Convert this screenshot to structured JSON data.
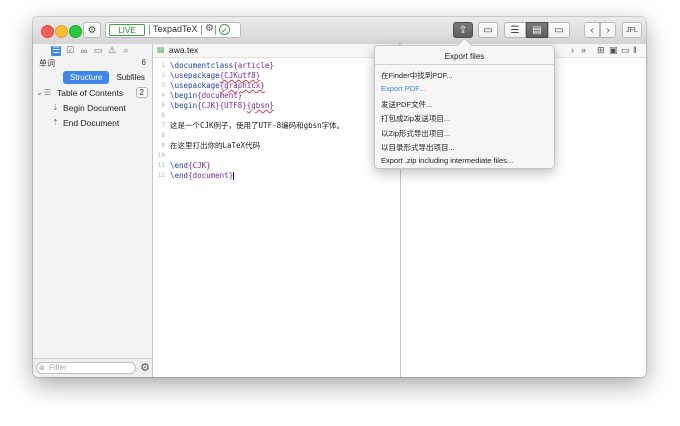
{
  "toolbar": {
    "status_live": "LIVE",
    "status_engine": "TexpadTeX",
    "right_label": "JFL"
  },
  "sidebar": {
    "crumb_title": "单词",
    "crumb_count": "6",
    "tabs": [
      "Structure",
      "Subfiles"
    ],
    "toc_label": "Table of Contents",
    "toc_count": "2",
    "items": [
      "Begin Document",
      "End Document"
    ],
    "filter_placeholder": "Filter"
  },
  "editor": {
    "filename": "awa.tex",
    "lines": [
      {
        "n": "1",
        "cmd": "\\documentclass",
        "arg": "{article}",
        "argul": ""
      },
      {
        "n": "2",
        "cmd": "\\usepackage",
        "arg": "",
        "argul": "{CJKutf8}"
      },
      {
        "n": "3",
        "cmd": "\\usepackage",
        "arg": "",
        "argul": "{graphicx}"
      },
      {
        "n": "4",
        "cmd": "\\begin",
        "arg": "{document}",
        "argul": ""
      },
      {
        "n": "5",
        "cmd": "\\begin",
        "arg": "{CJK}{UTF8}",
        "argul": "{gbsn}"
      },
      {
        "n": "6",
        "text": ""
      },
      {
        "n": "7",
        "text": "这是一个CJK例子，使用了UTF-8编码和gbsn字体。"
      },
      {
        "n": "8",
        "text": ""
      },
      {
        "n": "9",
        "text": "在这里打出你的LaTeX代码"
      },
      {
        "n": "10",
        "text": ""
      },
      {
        "n": "11",
        "cmd": "\\end",
        "arg": "{CJK}",
        "argul": ""
      },
      {
        "n": "12",
        "cmd": "\\end",
        "arg": "{document}",
        "argul": ""
      }
    ]
  },
  "popup": {
    "title": "Export files",
    "items": [
      "在Finder中找到PDF...",
      "Export PDF...",
      "发送PDF文件...",
      "打包成Zip发送项目...",
      "以Zip形式导出项目...",
      "以目录形式导出项目...",
      "Export .zip including intermediate files..."
    ]
  },
  "colors": {
    "accent": "#3e86e8",
    "live_green": "#2b8c2b",
    "command_blue": "#1e3fb8"
  }
}
